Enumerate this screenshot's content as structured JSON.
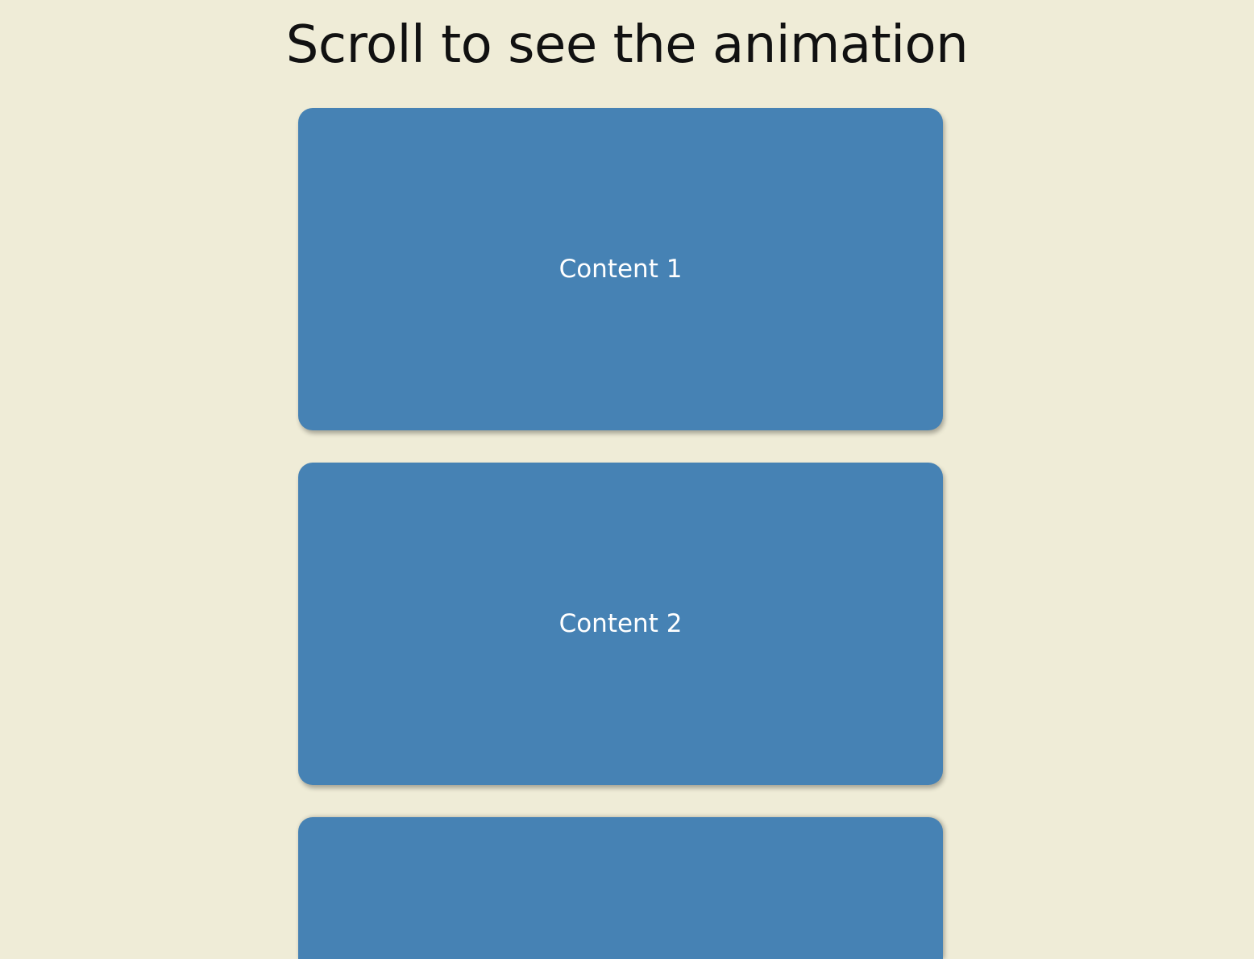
{
  "page": {
    "title": "Scroll to see the animation"
  },
  "boxes": [
    {
      "label": "Content 1"
    },
    {
      "label": "Content 2"
    },
    {
      "label": ""
    }
  ],
  "colors": {
    "background": "#efecd7",
    "box": "#4682b4",
    "box_text": "#ffffff",
    "title_text": "#111111"
  }
}
